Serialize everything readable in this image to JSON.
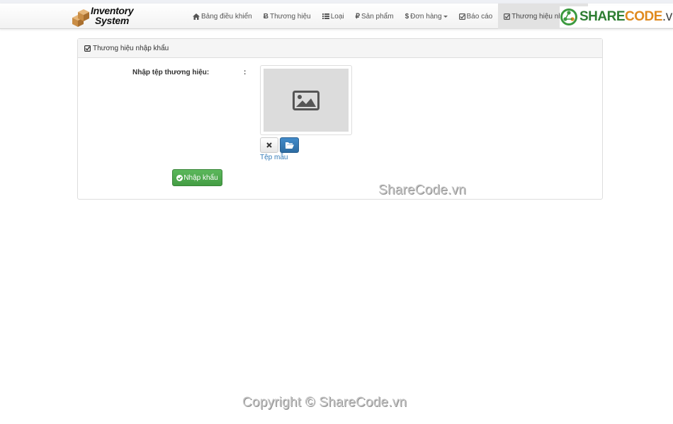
{
  "brand": {
    "line1": "Inventory",
    "line2": "System"
  },
  "nav": {
    "items": [
      {
        "label": "Bảng điều khiển",
        "icon": "home-icon"
      },
      {
        "label": "Thương hiệu",
        "icon": "bitcoin-icon"
      },
      {
        "label": "Loại",
        "icon": "list-icon"
      },
      {
        "label": "Sản phẩm",
        "icon": "ruble-icon"
      },
      {
        "label": "Đơn hàng",
        "icon": "dollar-icon"
      },
      {
        "label": "Báo cáo",
        "icon": "check-square-icon"
      },
      {
        "label": "Thương hiệu nhập",
        "icon": "check-square-icon"
      }
    ]
  },
  "sharecode_logo": {
    "share": "SHARE",
    "code": "CODE",
    "vn": ".vn"
  },
  "panel": {
    "title": "Thương hiệu nhập khẩu",
    "field_label": "Nhập tệp thương hiệu:",
    "colon": ":",
    "sample_link": "Tệp mẫu",
    "import_button": "Nhập khẩu"
  },
  "watermarks": {
    "middle": "ShareCode.vn",
    "bottom": "Copyright © ShareCode.vn"
  },
  "colors": {
    "primary": "#337ab7",
    "success": "#5cb85c",
    "nav_active": "#e2e2e2"
  }
}
